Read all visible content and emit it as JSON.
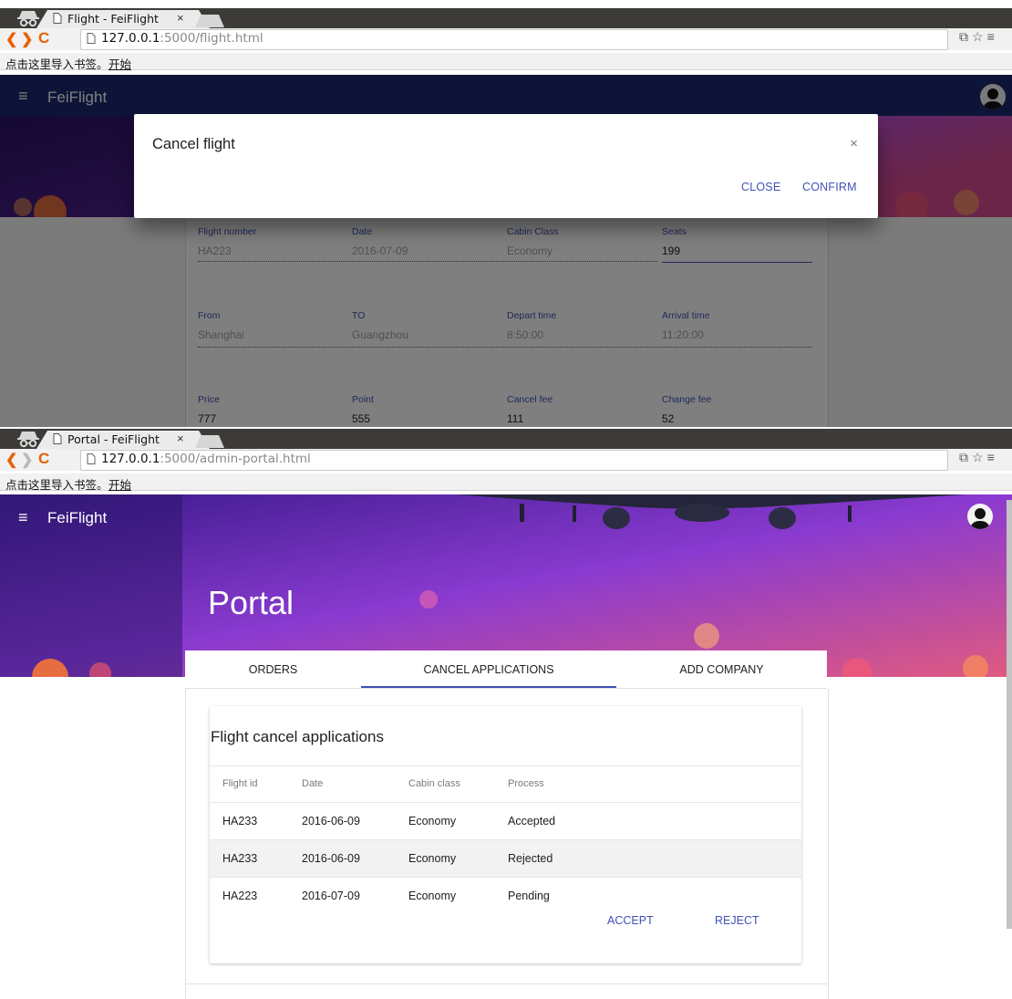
{
  "window1": {
    "tab_title": "Flight - FeiFlight",
    "tab_close": "×",
    "url_host": "127.0.0.1",
    "url_path": ":5000/flight.html",
    "bookmarks_text": "点击这里导入书签。",
    "bookmarks_link": "开始",
    "app_title": "FeiFlight",
    "dialog": {
      "title": "Cancel flight",
      "close_x": "×",
      "close_label": "CLOSE",
      "confirm_label": "CONFIRM"
    },
    "fields_row1": [
      {
        "label": "Flight number",
        "value": "HA223"
      },
      {
        "label": "Date",
        "value": "2016-07-09"
      },
      {
        "label": "Cabin Class",
        "value": "Economy"
      },
      {
        "label": "Seats",
        "value": "199"
      }
    ],
    "fields_row2": [
      {
        "label": "From",
        "value": "Shanghai"
      },
      {
        "label": "TO",
        "value": "Guangzhou"
      },
      {
        "label": "Depart time",
        "value": "8:50:00"
      },
      {
        "label": "Arrival time",
        "value": "11:20:00"
      }
    ],
    "fields_row3": [
      {
        "label": "Price",
        "value": "777"
      },
      {
        "label": "Point",
        "value": "555"
      },
      {
        "label": "Cancel fee",
        "value": "111"
      },
      {
        "label": "Change fee",
        "value": "52"
      }
    ]
  },
  "window2": {
    "tab_title": "Portal - FeiFlight",
    "tab_close": "×",
    "url_host": "127.0.0.1",
    "url_path": ":5000/admin-portal.html",
    "bookmarks_text": "点击这里导入书签。",
    "bookmarks_link": "开始",
    "app_title": "FeiFlight",
    "hero_title": "Portal",
    "tabs": [
      {
        "label": "ORDERS"
      },
      {
        "label": "CANCEL APPLICATIONS",
        "active": true
      },
      {
        "label": "ADD COMPANY"
      }
    ],
    "card_title": "Flight cancel applications",
    "columns": [
      "Flight id",
      "Date",
      "Cabin class",
      "Process"
    ],
    "rows": [
      {
        "flight_id": "HA233",
        "date": "2016-06-09",
        "cabin": "Economy",
        "process": "Accepted"
      },
      {
        "flight_id": "HA233",
        "date": "2016-06-09",
        "cabin": "Economy",
        "process": "Rejected"
      },
      {
        "flight_id": "HA223",
        "date": "2016-07-09",
        "cabin": "Economy",
        "process": "Pending"
      }
    ],
    "accept_label": "ACCEPT",
    "reject_label": "REJECT"
  },
  "colors": {
    "primary": "#3f51b5",
    "appbar": "#1a2870",
    "chrome_titlebar": "#3c3b37",
    "chrome_accent": "#e66000"
  },
  "icons": [
    "incognito-icon",
    "document-icon",
    "back-icon",
    "forward-icon",
    "reload-icon",
    "translate-icon",
    "star-icon",
    "menu-icon",
    "hamburger-icon",
    "avatar-icon",
    "close-icon"
  ]
}
